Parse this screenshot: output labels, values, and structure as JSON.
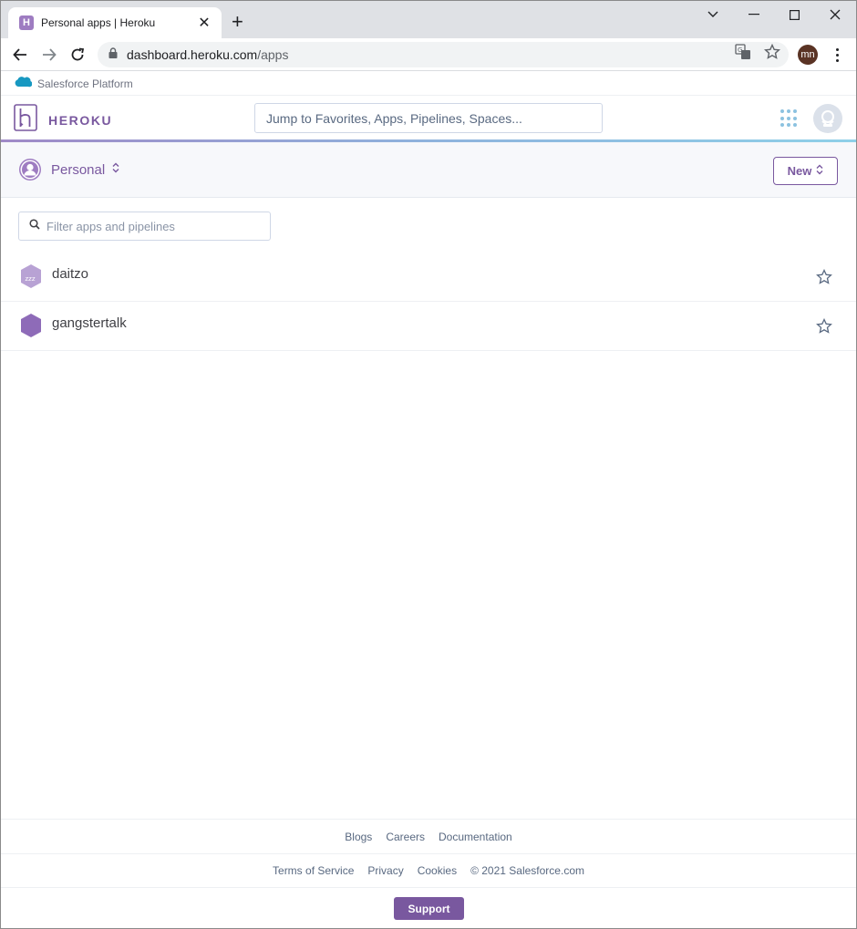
{
  "browser": {
    "tab_title": "Personal apps | Heroku",
    "tab_favicon_letter": "H",
    "url_host": "dashboard.heroku.com",
    "url_path": "/apps",
    "profile_initials": "mn"
  },
  "platform_bar": {
    "label": "Salesforce Platform"
  },
  "header": {
    "brand": "HEROKU",
    "jump_placeholder": "Jump to Favorites, Apps, Pipelines, Spaces..."
  },
  "subheader": {
    "team_name": "Personal",
    "new_label": "New"
  },
  "filter": {
    "placeholder": "Filter apps and pipelines"
  },
  "apps": [
    {
      "name": "daitzo",
      "state": "sleeping",
      "badge": "zzz"
    },
    {
      "name": "gangstertalk",
      "state": "active"
    }
  ],
  "footer": {
    "links_top": [
      "Blogs",
      "Careers",
      "Documentation"
    ],
    "links_bottom": [
      "Terms of Service",
      "Privacy",
      "Cookies"
    ],
    "copyright": "© 2021 Salesforce.com",
    "support_label": "Support"
  },
  "colors": {
    "heroku_purple": "#79589f",
    "hex_sleeping": "#b8a2d4",
    "hex_active": "#8e6bb8",
    "salesforce_blue": "#1798c1"
  }
}
